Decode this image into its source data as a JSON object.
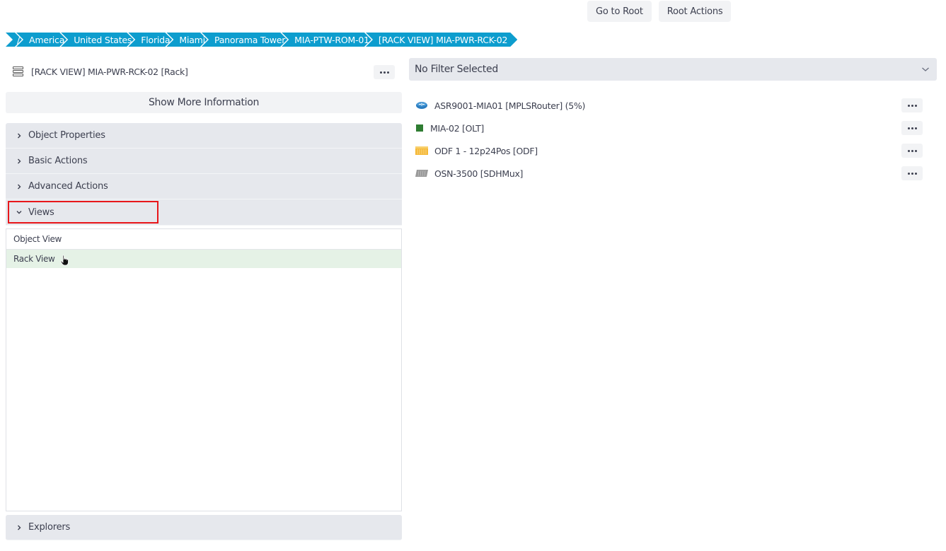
{
  "top_buttons": {
    "go_to_root": "Go to Root",
    "root_actions": "Root Actions"
  },
  "breadcrumb": [
    {
      "label": "/"
    },
    {
      "label": "America"
    },
    {
      "label": "United States"
    },
    {
      "label": "Florida"
    },
    {
      "label": "Miami"
    },
    {
      "label": "Panorama Tower"
    },
    {
      "label": "MIA-PTW-ROM-01"
    },
    {
      "label": "[RACK VIEW] MIA-PWR-RCK-02"
    }
  ],
  "object": {
    "icon": "rack-icon",
    "title": "[RACK VIEW] MIA-PWR-RCK-02 [Rack]"
  },
  "show_more_label": "Show More Information",
  "accordion": {
    "object_properties": "Object Properties",
    "basic_actions": "Basic Actions",
    "advanced_actions": "Advanced Actions",
    "views": "Views",
    "explorers": "Explorers"
  },
  "views": [
    {
      "label": "Object View"
    },
    {
      "label": "Rack View"
    }
  ],
  "filter": {
    "selected": "No Filter Selected"
  },
  "devices": [
    {
      "name": "ASR9001-MIA01 [MPLSRouter] (5%)",
      "icon": "router-icon"
    },
    {
      "name": "MIA-02 [OLT]",
      "icon": "olt-icon"
    },
    {
      "name": "ODF 1 - 12p24Pos [ODF]",
      "icon": "odf-icon"
    },
    {
      "name": "OSN-3500 [SDHMux]",
      "icon": "sdhmux-icon"
    }
  ],
  "colors": {
    "breadcrumb_bg": "#0d9dce",
    "highlight": "#e8161a",
    "hover_row": "#e5f2e6",
    "olt_green": "#2f7d32"
  }
}
